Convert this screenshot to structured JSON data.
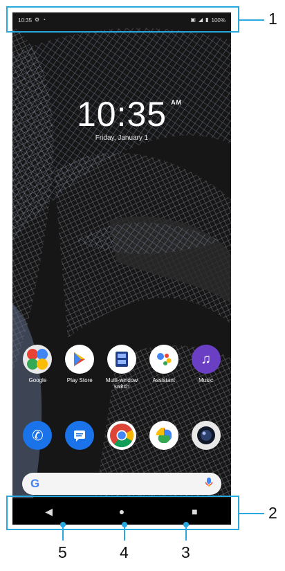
{
  "status_bar": {
    "time": "10:35",
    "battery": "100%",
    "left_icons": [
      "settings-icon",
      "notification-icon"
    ],
    "right_icons": [
      "vibrate-icon",
      "signal-icon",
      "battery-icon"
    ]
  },
  "lock_clock": {
    "time": "10:35",
    "ampm": "AM",
    "date": "Friday, January 1"
  },
  "apps_row1": [
    {
      "label": "Google",
      "icon": "google-folder-icon"
    },
    {
      "label": "Play Store",
      "icon": "play-store-icon"
    },
    {
      "label": "Multi-window switch",
      "icon": "multi-window-icon"
    },
    {
      "label": "Assistant",
      "icon": "assistant-icon"
    },
    {
      "label": "Music",
      "icon": "music-icon"
    }
  ],
  "dock": [
    {
      "icon": "phone-icon"
    },
    {
      "icon": "messages-icon"
    },
    {
      "icon": "chrome-icon"
    },
    {
      "icon": "photos-icon"
    },
    {
      "icon": "camera-icon"
    }
  ],
  "search": {
    "logo": "G",
    "icon": "mic-icon"
  },
  "nav": {
    "back": "◀",
    "home": "●",
    "recents": "■"
  },
  "callouts": {
    "n1": "1",
    "n2": "2",
    "n3": "3",
    "n4": "4",
    "n5": "5"
  },
  "colors": {
    "callout": "#29a8e0",
    "wallpaper": "#151515",
    "google_blue": "#4285F4"
  }
}
